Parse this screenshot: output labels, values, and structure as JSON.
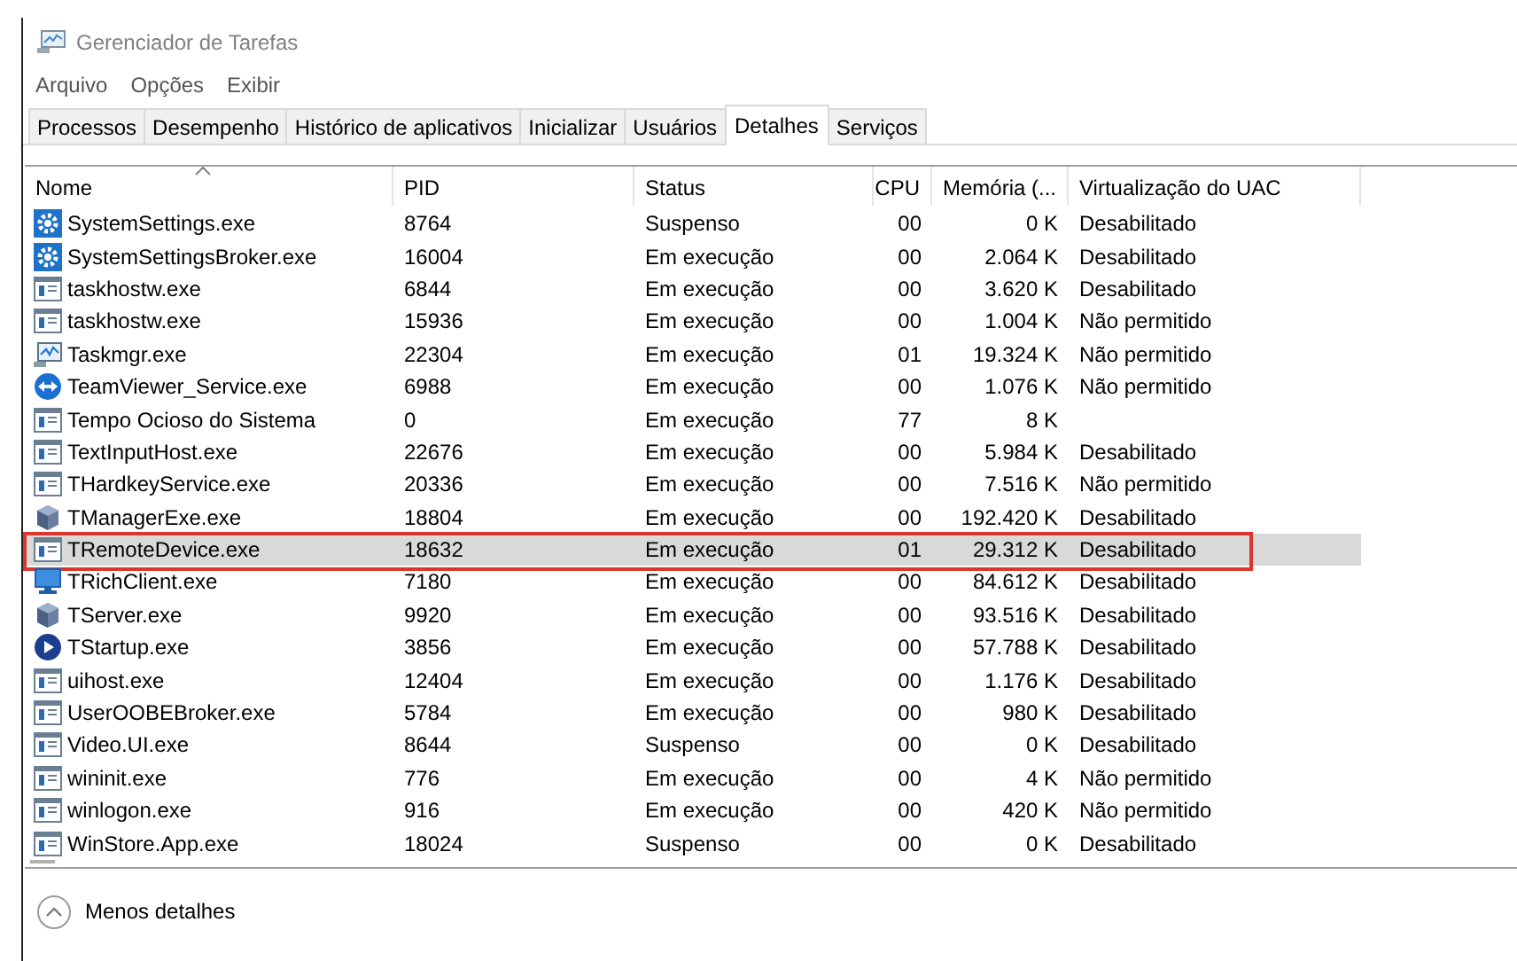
{
  "window": {
    "title": "Gerenciador de Tarefas"
  },
  "menu": [
    "Arquivo",
    "Opções",
    "Exibir"
  ],
  "tabs": [
    {
      "label": "Processos",
      "selected": false
    },
    {
      "label": "Desempenho",
      "selected": false
    },
    {
      "label": "Histórico de aplicativos",
      "selected": false
    },
    {
      "label": "Inicializar",
      "selected": false
    },
    {
      "label": "Usuários",
      "selected": false
    },
    {
      "label": "Detalhes",
      "selected": true
    },
    {
      "label": "Serviços",
      "selected": false
    }
  ],
  "table": {
    "columns": [
      {
        "label": "Nome",
        "sorted": true
      },
      {
        "label": "PID",
        "sorted": false
      },
      {
        "label": "Status",
        "sorted": false
      },
      {
        "label": "CPU",
        "sorted": false
      },
      {
        "label": "Memória (...",
        "sorted": false
      },
      {
        "label": "Virtualização do UAC",
        "sorted": false
      }
    ],
    "rows": [
      {
        "kind": "gear",
        "cells": [
          "SystemSettings.exe",
          "8764",
          "Suspenso",
          "00",
          "0 K",
          "Desabilitado"
        ],
        "selected": false,
        "outlined": false
      },
      {
        "kind": "gear",
        "cells": [
          "SystemSettingsBroker.exe",
          "16004",
          "Em execução",
          "00",
          "2.064 K",
          "Desabilitado"
        ],
        "selected": false,
        "outlined": false
      },
      {
        "kind": "window",
        "cells": [
          "taskhostw.exe",
          "6844",
          "Em execução",
          "00",
          "3.620 K",
          "Desabilitado"
        ],
        "selected": false,
        "outlined": false
      },
      {
        "kind": "window",
        "cells": [
          "taskhostw.exe",
          "15936",
          "Em execução",
          "00",
          "1.004 K",
          "Não permitido"
        ],
        "selected": false,
        "outlined": false
      },
      {
        "kind": "monitor-chart",
        "cells": [
          "Taskmgr.exe",
          "22304",
          "Em execução",
          "01",
          "19.324 K",
          "Não permitido"
        ],
        "selected": false,
        "outlined": false
      },
      {
        "kind": "arrows",
        "cells": [
          "TeamViewer_Service.exe",
          "6988",
          "Em execução",
          "00",
          "1.076 K",
          "Não permitido"
        ],
        "selected": false,
        "outlined": false
      },
      {
        "kind": "window",
        "cells": [
          "Tempo Ocioso do Sistema",
          "0",
          "Em execução",
          "77",
          "8 K"
        ],
        "selected": false,
        "outlined": false
      },
      {
        "kind": "window",
        "cells": [
          "TextInputHost.exe",
          "22676",
          "Em execução",
          "00",
          "5.984 K",
          "Desabilitado"
        ],
        "selected": false,
        "outlined": false
      },
      {
        "kind": "window",
        "cells": [
          "THardkeyService.exe",
          "20336",
          "Em execução",
          "00",
          "7.516 K",
          "Não permitido"
        ],
        "selected": false,
        "outlined": false
      },
      {
        "kind": "cube",
        "cells": [
          "TManagerExe.exe",
          "18804",
          "Em execução",
          "00",
          "192.420 K",
          "Desabilitado"
        ],
        "selected": false,
        "outlined": false
      },
      {
        "kind": "window",
        "cells": [
          "TRemoteDevice.exe",
          "18632",
          "Em execução",
          "01",
          "29.312 K",
          "Desabilitado"
        ],
        "selected": true,
        "outlined": true
      },
      {
        "kind": "monitor",
        "cells": [
          "TRichClient.exe",
          "7180",
          "Em execução",
          "00",
          "84.612 K",
          "Desabilitado"
        ],
        "selected": false,
        "outlined": false
      },
      {
        "kind": "cube",
        "cells": [
          "TServer.exe",
          "9920",
          "Em execução",
          "00",
          "93.516 K",
          "Desabilitado"
        ],
        "selected": false,
        "outlined": false
      },
      {
        "kind": "play",
        "cells": [
          "TStartup.exe",
          "3856",
          "Em execução",
          "00",
          "57.788 K",
          "Desabilitado"
        ],
        "selected": false,
        "outlined": false
      },
      {
        "kind": "window",
        "cells": [
          "uihost.exe",
          "12404",
          "Em execução",
          "00",
          "1.176 K",
          "Desabilitado"
        ],
        "selected": false,
        "outlined": false
      },
      {
        "kind": "window",
        "cells": [
          "UserOOBEBroker.exe",
          "5784",
          "Em execução",
          "00",
          "980 K",
          "Desabilitado"
        ],
        "selected": false,
        "outlined": false
      },
      {
        "kind": "window",
        "cells": [
          "Video.UI.exe",
          "8644",
          "Suspenso",
          "00",
          "0 K",
          "Desabilitado"
        ],
        "selected": false,
        "outlined": false
      },
      {
        "kind": "window",
        "cells": [
          "wininit.exe",
          "776",
          "Em execução",
          "00",
          "4 K",
          "Não permitido"
        ],
        "selected": false,
        "outlined": false
      },
      {
        "kind": "window",
        "cells": [
          "winlogon.exe",
          "916",
          "Em execução",
          "00",
          "420 K",
          "Não permitido"
        ],
        "selected": false,
        "outlined": false
      },
      {
        "kind": "window",
        "cells": [
          "WinStore.App.exe",
          "18024",
          "Suspenso",
          "00",
          "0 K",
          "Desabilitado"
        ],
        "selected": false,
        "outlined": false
      }
    ]
  },
  "footer": {
    "label": "Menos detalhes"
  }
}
